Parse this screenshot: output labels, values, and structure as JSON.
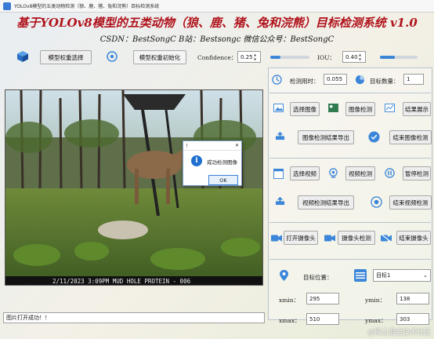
{
  "window": {
    "title": "YOLOv8模型的五类动物检测（狼、鹿、猪、兔和浣熊）目标检测系统",
    "main_title": "基于YOLOv8模型的五类动物（狼、鹿、猪、兔和浣熊）目标检测系统 v1.0",
    "subtitle": "CSDN：BestSongC   B站：Bestsongc   微信公众号：BestSongC"
  },
  "toolbar": {
    "select_weights": "模型权重选择",
    "init_weights": "模型权重初始化",
    "confidence_label": "Confidence：",
    "confidence_value": "0.25",
    "confidence_level": 0.25,
    "iou_label": "IOU：",
    "iou_value": "0.40",
    "iou_level": 0.4
  },
  "image": {
    "stamp": "2/11/2023   3:09PM   MUD HOLE PROTEIN - 006"
  },
  "status": {
    "text": "图片打开成功！！"
  },
  "dialog": {
    "title": "！",
    "message": "成功检测图像",
    "ok": "OK"
  },
  "right_panel": {
    "time_label": "检测用时：",
    "time_value": "0.055",
    "count_label": "目标数量：",
    "count_value": "1",
    "image_buttons": {
      "select_image": "选择图像",
      "detect_image": "图像检测",
      "show_result": "结果展示"
    },
    "image_export": {
      "export": "图像检测结果导出",
      "stop": "结束图像检测"
    },
    "video_buttons": {
      "select_video": "选择视频",
      "detect_video": "视频检测",
      "pause": "暂停检测"
    },
    "video_export": {
      "export": "视频检测结果导出",
      "stop": "结束视频检测"
    },
    "camera_buttons": {
      "open_camera": "打开摄像头",
      "detect_camera": "摄像头检测",
      "stop": "结束摄像头"
    },
    "target": {
      "position_label": "目标位置：",
      "combo_value": "目标1",
      "xmin_label": "xmin：",
      "xmin": "295",
      "ymin_label": "ymin：",
      "ymin": "138",
      "xmax_label": "xmax：",
      "xmax": "510",
      "ymax_label": "ymax：",
      "ymax": "303"
    }
  },
  "watermark": "@稀土掘金技术社区",
  "colors": {
    "title_red": "#b0131c",
    "accent_blue": "#3b86d8"
  }
}
